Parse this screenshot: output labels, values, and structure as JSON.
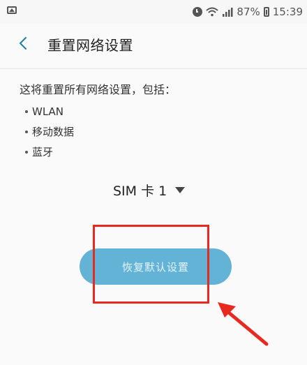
{
  "status_bar": {
    "battery_percent": "87%",
    "time": "15:39",
    "icons": [
      "image-icon",
      "alarm-icon",
      "wifi-icon",
      "signal-icon",
      "battery-icon"
    ]
  },
  "header": {
    "title": "重置网络设置",
    "back_icon": "chevron-left-icon"
  },
  "content": {
    "description": "这将重置所有网络设置，包括：",
    "items": [
      "WLAN",
      "移动数据",
      "蓝牙"
    ]
  },
  "sim_selector": {
    "value": "SIM 卡 1",
    "icon": "caret-down-icon"
  },
  "action": {
    "reset_label": "恢复默认设置"
  },
  "colors": {
    "accent": "#62b3d6",
    "annotation": "#e8291f"
  }
}
